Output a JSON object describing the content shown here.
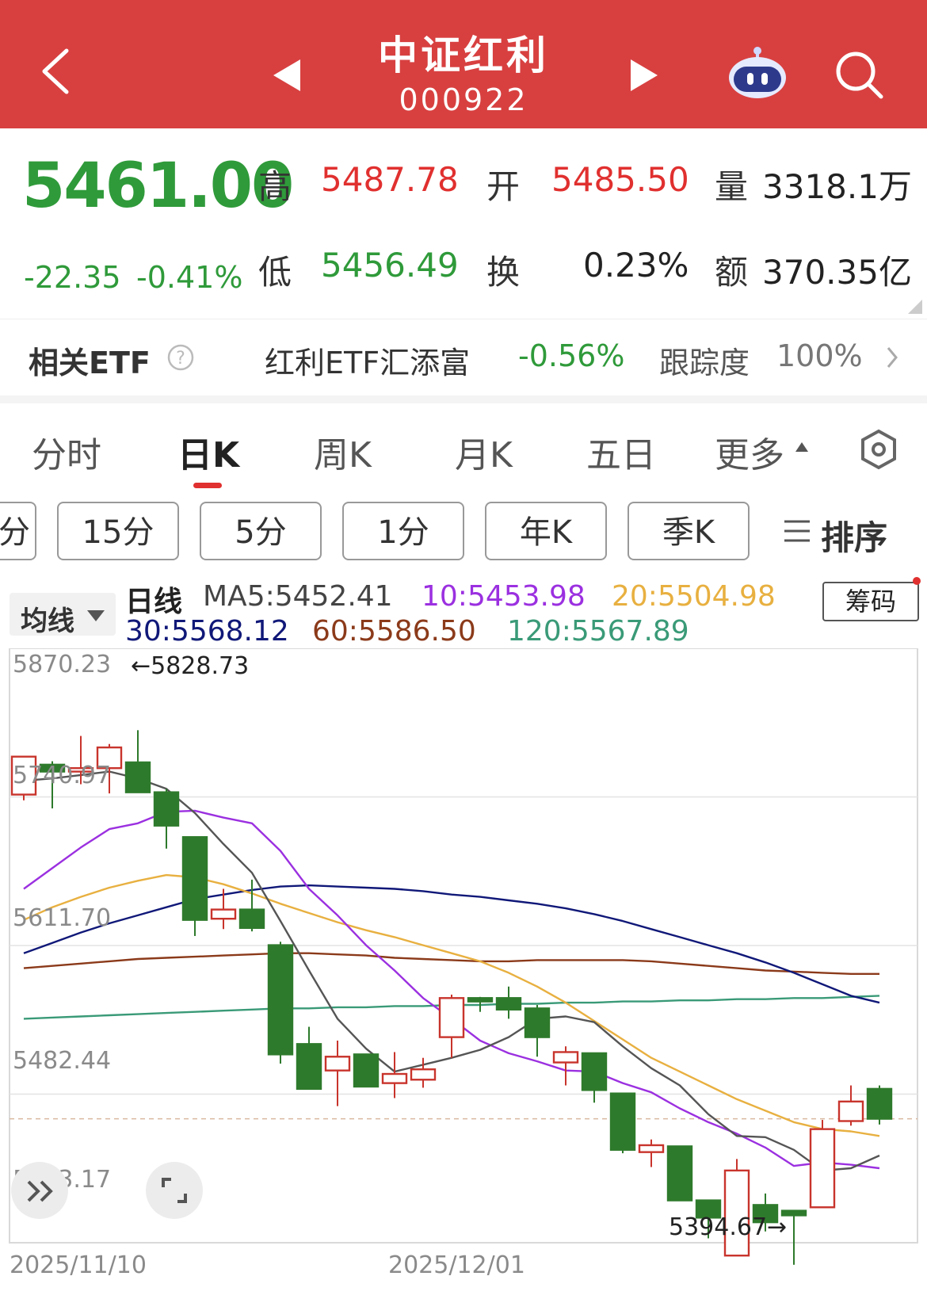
{
  "header": {
    "title": "中证红利",
    "code": "000922",
    "colors": {
      "bar": "#d84040"
    },
    "icons": [
      "back-icon",
      "prev-icon",
      "next-icon",
      "robot-assistant-icon",
      "search-icon"
    ]
  },
  "quote": {
    "price": "5461.00",
    "change": "-22.35",
    "change_pct": "-0.41%",
    "high_label": "高",
    "high": "5487.78",
    "open_label": "开",
    "open": "5485.50",
    "volume_label": "量",
    "volume": "3318.1万",
    "low_label": "低",
    "low": "5456.49",
    "turnover_label": "换",
    "turnover": "0.23%",
    "amount_label": "额",
    "amount": "370.35亿"
  },
  "etf": {
    "label": "相关ETF",
    "name": "红利ETF汇添富",
    "change": "-0.56%",
    "tracking_label": "跟踪度",
    "tracking": "100%"
  },
  "tabs": [
    "分时",
    "日K",
    "周K",
    "月K",
    "五日",
    "更多"
  ],
  "active_tab": "日K",
  "sub_buttons": [
    "分",
    "15分",
    "5分",
    "1分",
    "年K",
    "季K"
  ],
  "sort_label": "排序",
  "ma_bar": {
    "selector": "均线",
    "period": "日线",
    "ma5": "MA5:5452.41",
    "ma10": "10:5453.98",
    "ma20": "20:5504.98",
    "ma30": "30:5568.12",
    "ma60": "60:5586.50",
    "ma120": "120:5567.89",
    "chips_button": "筹码",
    "colors": {
      "ma5": "#555555",
      "ma10": "#9b30e0",
      "ma20": "#e8b040",
      "ma30": "#101878",
      "ma60": "#8b3a1a",
      "ma120": "#3a9a78"
    }
  },
  "chart_data": {
    "type": "candlestick",
    "y_axis_labels": [
      "5870.23",
      "5740.97",
      "5611.70",
      "5482.44",
      "5353.17"
    ],
    "x_axis_labels": [
      "2025/11/10",
      "2025/12/01"
    ],
    "max_annotation": "←5828.73",
    "min_annotation": "5394.67→",
    "ylim": [
      5353.17,
      5870.23
    ],
    "last_close": 5461.0,
    "candles": [
      {
        "o": 5743,
        "c": 5776,
        "h": 5776,
        "l": 5738
      },
      {
        "o": 5769,
        "c": 5763,
        "h": 5772,
        "l": 5731
      },
      {
        "o": 5763,
        "c": 5766,
        "h": 5794,
        "l": 5752
      },
      {
        "o": 5766,
        "c": 5784,
        "h": 5787,
        "l": 5744
      },
      {
        "o": 5771,
        "c": 5745,
        "h": 5799,
        "l": 5745
      },
      {
        "o": 5745,
        "c": 5716,
        "h": 5748,
        "l": 5696
      },
      {
        "o": 5706,
        "c": 5634,
        "h": 5706,
        "l": 5620
      },
      {
        "o": 5635,
        "c": 5643,
        "h": 5661,
        "l": 5626
      },
      {
        "o": 5643,
        "c": 5627,
        "h": 5669,
        "l": 5624
      },
      {
        "o": 5612,
        "c": 5517,
        "h": 5615,
        "l": 5509
      },
      {
        "o": 5526,
        "c": 5487,
        "h": 5541,
        "l": 5487
      },
      {
        "o": 5503,
        "c": 5515,
        "h": 5529,
        "l": 5472
      },
      {
        "o": 5517,
        "c": 5489,
        "h": 5517,
        "l": 5489
      },
      {
        "o": 5492,
        "c": 5500,
        "h": 5519,
        "l": 5479
      },
      {
        "o": 5495,
        "c": 5504,
        "h": 5514,
        "l": 5488
      },
      {
        "o": 5532,
        "c": 5566,
        "h": 5569,
        "l": 5514
      },
      {
        "o": 5566,
        "c": 5563,
        "h": 5567,
        "l": 5554
      },
      {
        "o": 5566,
        "c": 5556,
        "h": 5576,
        "l": 5548
      },
      {
        "o": 5557,
        "c": 5532,
        "h": 5560,
        "l": 5515
      },
      {
        "o": 5510,
        "c": 5519,
        "h": 5524,
        "l": 5490
      },
      {
        "o": 5518,
        "c": 5486,
        "h": 5518,
        "l": 5475
      },
      {
        "o": 5483,
        "c": 5434,
        "h": 5483,
        "l": 5431
      },
      {
        "o": 5432,
        "c": 5438,
        "h": 5443,
        "l": 5419
      },
      {
        "o": 5437,
        "c": 5390,
        "h": 5437,
        "l": 5390
      },
      {
        "o": 5390,
        "c": 5375,
        "h": 5390,
        "l": 5357
      },
      {
        "o": 5342,
        "c": 5416,
        "h": 5426,
        "l": 5342
      },
      {
        "o": 5386,
        "c": 5371,
        "h": 5396,
        "l": 5363
      },
      {
        "o": 5381,
        "c": 5377,
        "h": 5380,
        "l": 5334
      },
      {
        "o": 5384,
        "c": 5452,
        "h": 5460,
        "l": 5384
      },
      {
        "o": 5459,
        "c": 5476,
        "h": 5490,
        "l": 5455
      },
      {
        "o": 5487,
        "c": 5461,
        "h": 5490,
        "l": 5456
      }
    ],
    "ma_lines": {
      "ma5": [
        5755,
        5757,
        5760,
        5763,
        5757,
        5748,
        5727,
        5700,
        5675,
        5633,
        5590,
        5548,
        5522,
        5502,
        5508,
        5514,
        5521,
        5532,
        5548,
        5550,
        5545,
        5524,
        5505,
        5490,
        5465,
        5446,
        5445,
        5434,
        5416,
        5418,
        5429
      ],
      "ma10": [
        5661,
        5679,
        5697,
        5713,
        5718,
        5728,
        5729,
        5723,
        5718,
        5694,
        5661,
        5638,
        5612,
        5590,
        5566,
        5548,
        5529,
        5518,
        5511,
        5503,
        5502,
        5492,
        5484,
        5470,
        5458,
        5448,
        5436,
        5420,
        5423,
        5421,
        5418
      ],
      "ma20": [
        5634,
        5645,
        5654,
        5662,
        5668,
        5673,
        5671,
        5665,
        5657,
        5648,
        5640,
        5632,
        5625,
        5619,
        5612,
        5605,
        5598,
        5588,
        5576,
        5562,
        5546,
        5530,
        5514,
        5502,
        5490,
        5478,
        5468,
        5458,
        5452,
        5450,
        5446
      ],
      "ma30": [
        5605,
        5614,
        5623,
        5631,
        5638,
        5645,
        5652,
        5656,
        5660,
        5663,
        5664,
        5663,
        5662,
        5661,
        5659,
        5656,
        5654,
        5651,
        5648,
        5644,
        5639,
        5633,
        5626,
        5619,
        5612,
        5605,
        5597,
        5588,
        5578,
        5568,
        5562
      ],
      "ma60": [
        5592,
        5594,
        5596,
        5598,
        5600,
        5601,
        5602,
        5603,
        5604,
        5605,
        5605,
        5604,
        5603,
        5601,
        5600,
        5599,
        5598,
        5598,
        5599,
        5599,
        5599,
        5599,
        5598,
        5596,
        5594,
        5592,
        5590,
        5589,
        5588,
        5587,
        5587
      ],
      "ma120": [
        5548,
        5549,
        5550,
        5551,
        5552,
        5553,
        5554,
        5555,
        5556,
        5557,
        5557,
        5558,
        5558,
        5559,
        5559,
        5560,
        5560,
        5561,
        5561,
        5562,
        5562,
        5563,
        5563,
        5564,
        5564,
        5565,
        5565,
        5566,
        5566,
        5567,
        5568
      ]
    }
  }
}
